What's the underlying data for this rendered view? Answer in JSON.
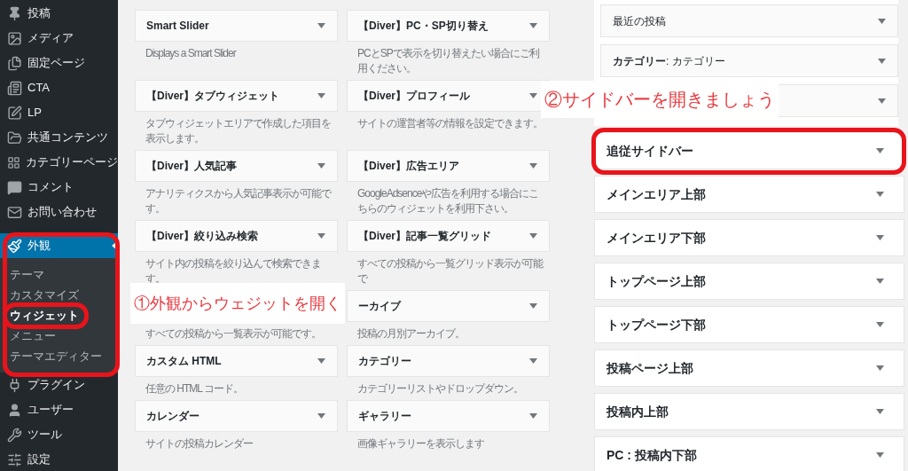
{
  "sidebar": {
    "items": [
      {
        "label": "投稿",
        "selected": false,
        "highlighted": false
      },
      {
        "label": "メディア",
        "selected": false,
        "highlighted": false
      },
      {
        "label": "固定ページ",
        "selected": false,
        "highlighted": false
      },
      {
        "label": "CTA",
        "selected": false,
        "highlighted": false
      },
      {
        "label": "LP",
        "selected": false,
        "highlighted": false
      },
      {
        "label": "共通コンテンツ",
        "selected": false,
        "highlighted": false
      },
      {
        "label": "カテゴリーページ",
        "selected": false,
        "highlighted": false
      },
      {
        "label": "コメント",
        "selected": false,
        "highlighted": false
      },
      {
        "label": "お問い合わせ",
        "selected": false,
        "highlighted": false
      },
      {
        "label": "外観",
        "selected": true,
        "highlighted": true,
        "children": [
          {
            "label": "テーマ",
            "selected": false,
            "highlighted": false
          },
          {
            "label": "カスタマイズ",
            "selected": false,
            "highlighted": false
          },
          {
            "label": "ウィジェット",
            "selected": true,
            "highlighted": true
          },
          {
            "label": "メニュー",
            "selected": false,
            "highlighted": false
          },
          {
            "label": "テーマエディター",
            "selected": false,
            "highlighted": false
          }
        ]
      },
      {
        "label": "プラグイン",
        "selected": false,
        "highlighted": false
      },
      {
        "label": "ユーザー",
        "selected": false,
        "highlighted": false
      },
      {
        "label": "ツール",
        "selected": false,
        "highlighted": false
      },
      {
        "label": "設定",
        "selected": false,
        "highlighted": false
      }
    ]
  },
  "available_widgets": [
    {
      "title": "Smart Slider",
      "description": "Displays a Smart Slider"
    },
    {
      "title": "【Diver】PC・SP切り替え",
      "description": "PCとSPで表示を切り替えたい場合にご利用ください。"
    },
    {
      "title": "【Diver】タブウィジェット",
      "description": "タブウィジェットエリアで作成した項目を表示します。"
    },
    {
      "title": "【Diver】プロフィール",
      "description": "サイトの運営者等の情報を設定できます。"
    },
    {
      "title": "【Diver】人気記事",
      "description": "アナリティクスから人気記事表示が可能です。"
    },
    {
      "title": "【Diver】広告エリア",
      "description": "GoogleAdsenceや広告を利用する場合にこちらのウィジェットを利用下さい。"
    },
    {
      "title": "【Diver】絞り込み検索",
      "description": "サイト内の投稿を絞り込んで検索できます。"
    },
    {
      "title": "【Diver】記事一覧グリッド",
      "description": "すべての投稿から一覧グリッド表示が可能で"
    },
    {
      "description": "すべての投稿から一覧表示が可能です。",
      "callout": "①外観からウェジットを開く"
    },
    {
      "title": "ーカイブ",
      "description": "投稿の月別アーカイブ。"
    },
    {
      "title": "カスタム HTML",
      "description": "任意の HTML コード。"
    },
    {
      "title": "カテゴリー",
      "description": "カテゴリーリストやドロップダウン。"
    },
    {
      "title": "カレンダー",
      "description": "サイトの投稿カレンダー"
    },
    {
      "title": "ギャラリー",
      "description": "画像ギャラリーを表示します"
    }
  ],
  "open_area": {
    "widgets": [
      {
        "kind": "widget",
        "title": "最近の投稿"
      },
      {
        "kind": "widget",
        "title": "**カテゴリー**: カテゴリー"
      },
      {
        "kind": "widget",
        "callout": "②サイドバーを開きましょう"
      }
    ]
  },
  "widget_areas": [
    {
      "title": "追従サイドバー",
      "highlighted": true
    },
    {
      "title": "メインエリア上部",
      "highlighted": false
    },
    {
      "title": "メインエリア下部",
      "highlighted": false
    },
    {
      "title": "トップページ上部",
      "highlighted": false
    },
    {
      "title": "トップページ下部",
      "highlighted": false
    },
    {
      "title": "投稿ページ上部",
      "highlighted": false
    },
    {
      "title": "投稿内上部",
      "highlighted": false
    },
    {
      "title": "PC : 投稿内下部",
      "highlighted": false
    }
  ]
}
